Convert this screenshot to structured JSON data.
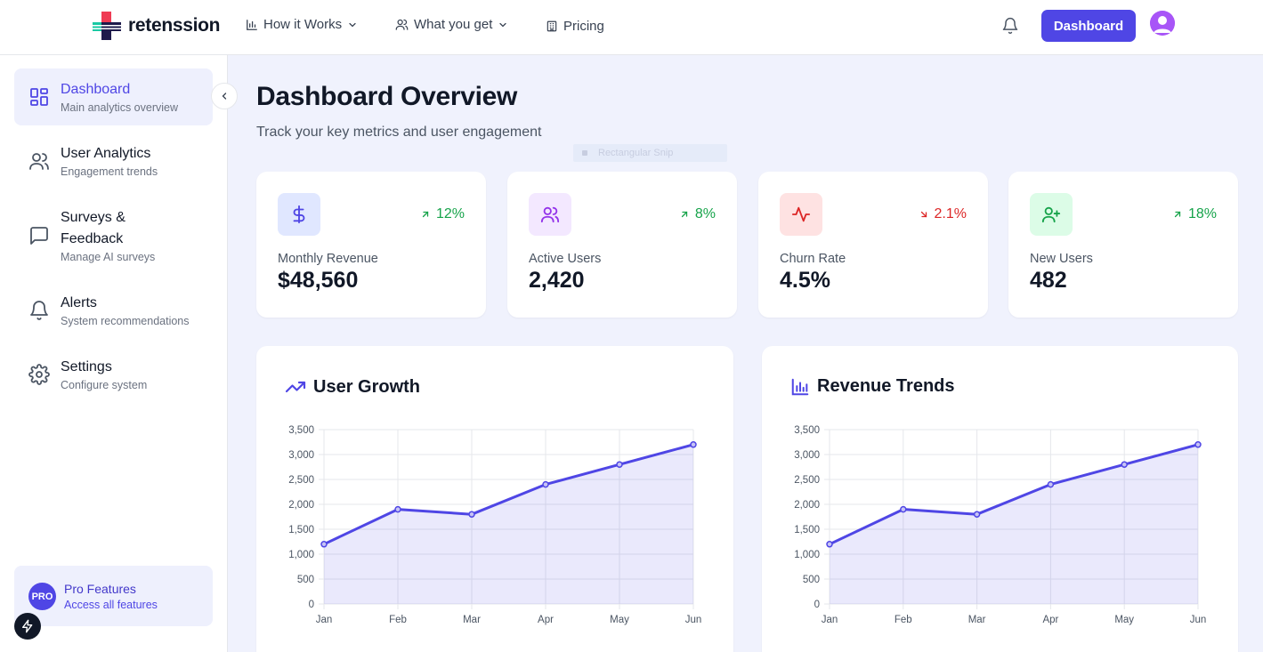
{
  "brand": {
    "name": "retenssion",
    "colors": {
      "red": "#ef3b54",
      "teal": "#19c9a3",
      "navy": "#1e1b4b"
    }
  },
  "nav": {
    "items": [
      {
        "label": "How it Works",
        "icon": "bar-chart-icon",
        "dropdown": true
      },
      {
        "label": "What you get",
        "icon": "users-icon",
        "dropdown": true
      },
      {
        "label": "Pricing",
        "icon": "building-icon",
        "dropdown": false
      }
    ],
    "dashboard_button": "Dashboard"
  },
  "sidebar": {
    "items": [
      {
        "title": "Dashboard",
        "subtitle": "Main analytics overview",
        "icon": "grid-icon",
        "active": true
      },
      {
        "title": "User Analytics",
        "subtitle": "Engagement trends",
        "icon": "users-icon",
        "active": false
      },
      {
        "title": "Surveys &",
        "title2": "Feedback",
        "subtitle": "Manage AI surveys",
        "icon": "message-icon",
        "active": false
      },
      {
        "title": "Alerts",
        "subtitle": "System recommendations",
        "icon": "bell-icon",
        "active": false
      },
      {
        "title": "Settings",
        "subtitle": "Configure system",
        "icon": "gear-icon",
        "active": false
      }
    ],
    "pro": {
      "badge": "PRO",
      "title": "Pro Features",
      "subtitle": "Access all features"
    }
  },
  "main": {
    "title": "Dashboard Overview",
    "subtitle": "Track your key metrics and user engagement",
    "ghost_overlay": "Rectangular Snip",
    "stats": [
      {
        "label": "Monthly Revenue",
        "value": "$48,560",
        "change": "12%",
        "trend": "up",
        "icon": "dollar-icon",
        "icon_bg": "#e0e7ff",
        "icon_color": "#4f46e5",
        "change_color": "#16a34a"
      },
      {
        "label": "Active Users",
        "value": "2,420",
        "change": "8%",
        "trend": "up",
        "icon": "users-icon",
        "icon_bg": "#f3e8ff",
        "icon_color": "#9333ea",
        "change_color": "#16a34a"
      },
      {
        "label": "Churn Rate",
        "value": "4.5%",
        "change": "2.1%",
        "trend": "down",
        "icon": "activity-icon",
        "icon_bg": "#fee2e2",
        "icon_color": "#dc2626",
        "change_color": "#dc2626"
      },
      {
        "label": "New Users",
        "value": "482",
        "change": "18%",
        "trend": "up",
        "icon": "user-plus-icon",
        "icon_bg": "#dcfce7",
        "icon_color": "#16a34a",
        "change_color": "#16a34a"
      }
    ]
  },
  "chart_data": [
    {
      "type": "area",
      "title": "User Growth",
      "categories": [
        "Jan",
        "Feb",
        "Mar",
        "Apr",
        "May",
        "Jun"
      ],
      "values": [
        1200,
        1900,
        1800,
        2400,
        2800,
        3200
      ],
      "ylim": [
        0,
        3500
      ],
      "yticks": [
        "0",
        "500",
        "1,000",
        "1,500",
        "2,000",
        "2,500",
        "3,000",
        "3,500"
      ],
      "grid": true,
      "color": "#4f46e5"
    },
    {
      "type": "area",
      "title": "Revenue Trends",
      "categories": [
        "Jan",
        "Feb",
        "Mar",
        "Apr",
        "May",
        "Jun"
      ],
      "values": [
        1200,
        1900,
        1800,
        2400,
        2800,
        3200
      ],
      "ylim": [
        0,
        3500
      ],
      "yticks": [
        "0",
        "500",
        "1,000",
        "1,500",
        "2,000",
        "2,500",
        "3,000",
        "3,500"
      ],
      "grid": true,
      "color": "#4f46e5"
    }
  ]
}
